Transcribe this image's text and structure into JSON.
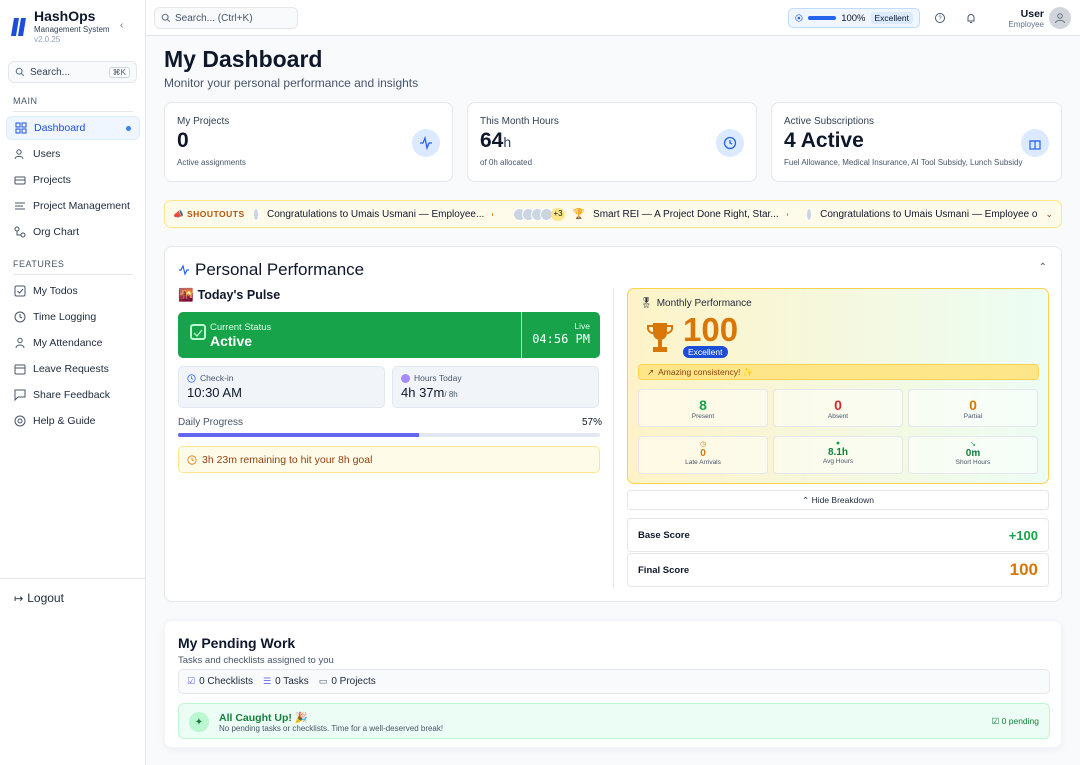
{
  "sidebar": {
    "brand": {
      "name": "HashOps",
      "subtitle": "Management System",
      "version": "v2.0.25"
    },
    "search": {
      "placeholder": "Search...",
      "shortcut": "⌘K"
    },
    "main_label": "MAIN",
    "features_label": "FEATURES",
    "main_items": [
      {
        "label": "Dashboard",
        "icon": "dashboard-icon",
        "active": true
      },
      {
        "label": "Users",
        "icon": "users-icon"
      },
      {
        "label": "Projects",
        "icon": "projects-icon"
      },
      {
        "label": "Project Management",
        "icon": "list-icon"
      },
      {
        "label": "Org Chart",
        "icon": "org-chart-icon"
      }
    ],
    "feature_items": [
      {
        "label": "My Todos",
        "icon": "check-square-icon"
      },
      {
        "label": "Time Logging",
        "icon": "clock-icon"
      },
      {
        "label": "My Attendance",
        "icon": "person-icon"
      },
      {
        "label": "Leave Requests",
        "icon": "calendar-icon"
      },
      {
        "label": "Share Feedback",
        "icon": "feedback-icon"
      },
      {
        "label": "Help & Guide",
        "icon": "help-icon"
      }
    ],
    "logout": "Logout"
  },
  "topbar": {
    "search_placeholder": "Search... (Ctrl+K)",
    "score": {
      "value": "100%",
      "badge": "Excellent",
      "progress": 1.0
    },
    "user": {
      "name": "User",
      "role": "Employee"
    }
  },
  "page": {
    "title": "My Dashboard",
    "subtitle": "Monitor your personal performance and insights"
  },
  "stats": [
    {
      "label": "My Projects",
      "value": "0",
      "unit": "",
      "sub": "Active assignments",
      "icon": "activity-icon"
    },
    {
      "label": "This Month Hours",
      "value": "64",
      "unit": "h",
      "sub": "of 0h allocated",
      "icon": "clock-icon"
    },
    {
      "label": "Active Subscriptions",
      "value": "4 Active",
      "unit": "",
      "sub": "Fuel Allowance, Medical Insurance, AI Tool Subsidy, Lunch Subsidy",
      "icon": "gift-icon"
    }
  ],
  "shoutouts": {
    "label": "SHOUTOUTS",
    "items": [
      "Congratulations to Umais Usmani — Employee...",
      "Smart REI — A Project Done Right, Star...",
      "Congratulations to Umais Usmani — Employee o"
    ],
    "more_count": "+3"
  },
  "performance": {
    "title": "Personal Performance",
    "pulse_title": "Today's Pulse",
    "status_label": "Current Status",
    "status_value": "Active",
    "live_label": "Live",
    "live_time": "04:56 PM",
    "checkin_label": "Check-in",
    "checkin_value": "10:30 AM",
    "hours_label": "Hours Today",
    "hours_value": "4h 37m",
    "hours_target": "/ 8h",
    "progress_label": "Daily Progress",
    "progress_pct": "57%",
    "progress_value": 0.57,
    "remaining": "3h 23m remaining to hit your 8h goal",
    "monthly": {
      "title": "Monthly Performance",
      "score": "100",
      "badge": "Excellent",
      "note": "Amazing consistency! ✨",
      "cells": [
        {
          "value": "8",
          "label": "Present",
          "color": "#16a34a"
        },
        {
          "value": "0",
          "label": "Absent",
          "color": "#dc2626"
        },
        {
          "value": "0",
          "label": "Partial",
          "color": "#d97706"
        },
        {
          "value": "0",
          "label": "Late Arrivals",
          "color": "#d97706"
        },
        {
          "value": "8.1h",
          "label": "Avg Hours",
          "color": "#16a34a"
        },
        {
          "value": "0m",
          "label": "Short Hours",
          "color": "#16a34a"
        }
      ]
    },
    "hide_breakdown": "Hide Breakdown",
    "base_score_label": "Base Score",
    "base_score_value": "+100",
    "final_score_label": "Final Score",
    "final_score_value": "100"
  },
  "pending": {
    "title": "My Pending Work",
    "subtitle": "Tasks and checklists assigned to you",
    "tabs": [
      "0 Checklists",
      "0 Tasks",
      "0 Projects"
    ],
    "caught_title": "All Caught Up! 🎉",
    "caught_desc": "No pending tasks or checklists. Time for a well-deserved break!",
    "caught_count": "0 pending"
  },
  "colors": {
    "accent": "#2563eb",
    "success": "#16a34a",
    "warning": "#d97706"
  }
}
